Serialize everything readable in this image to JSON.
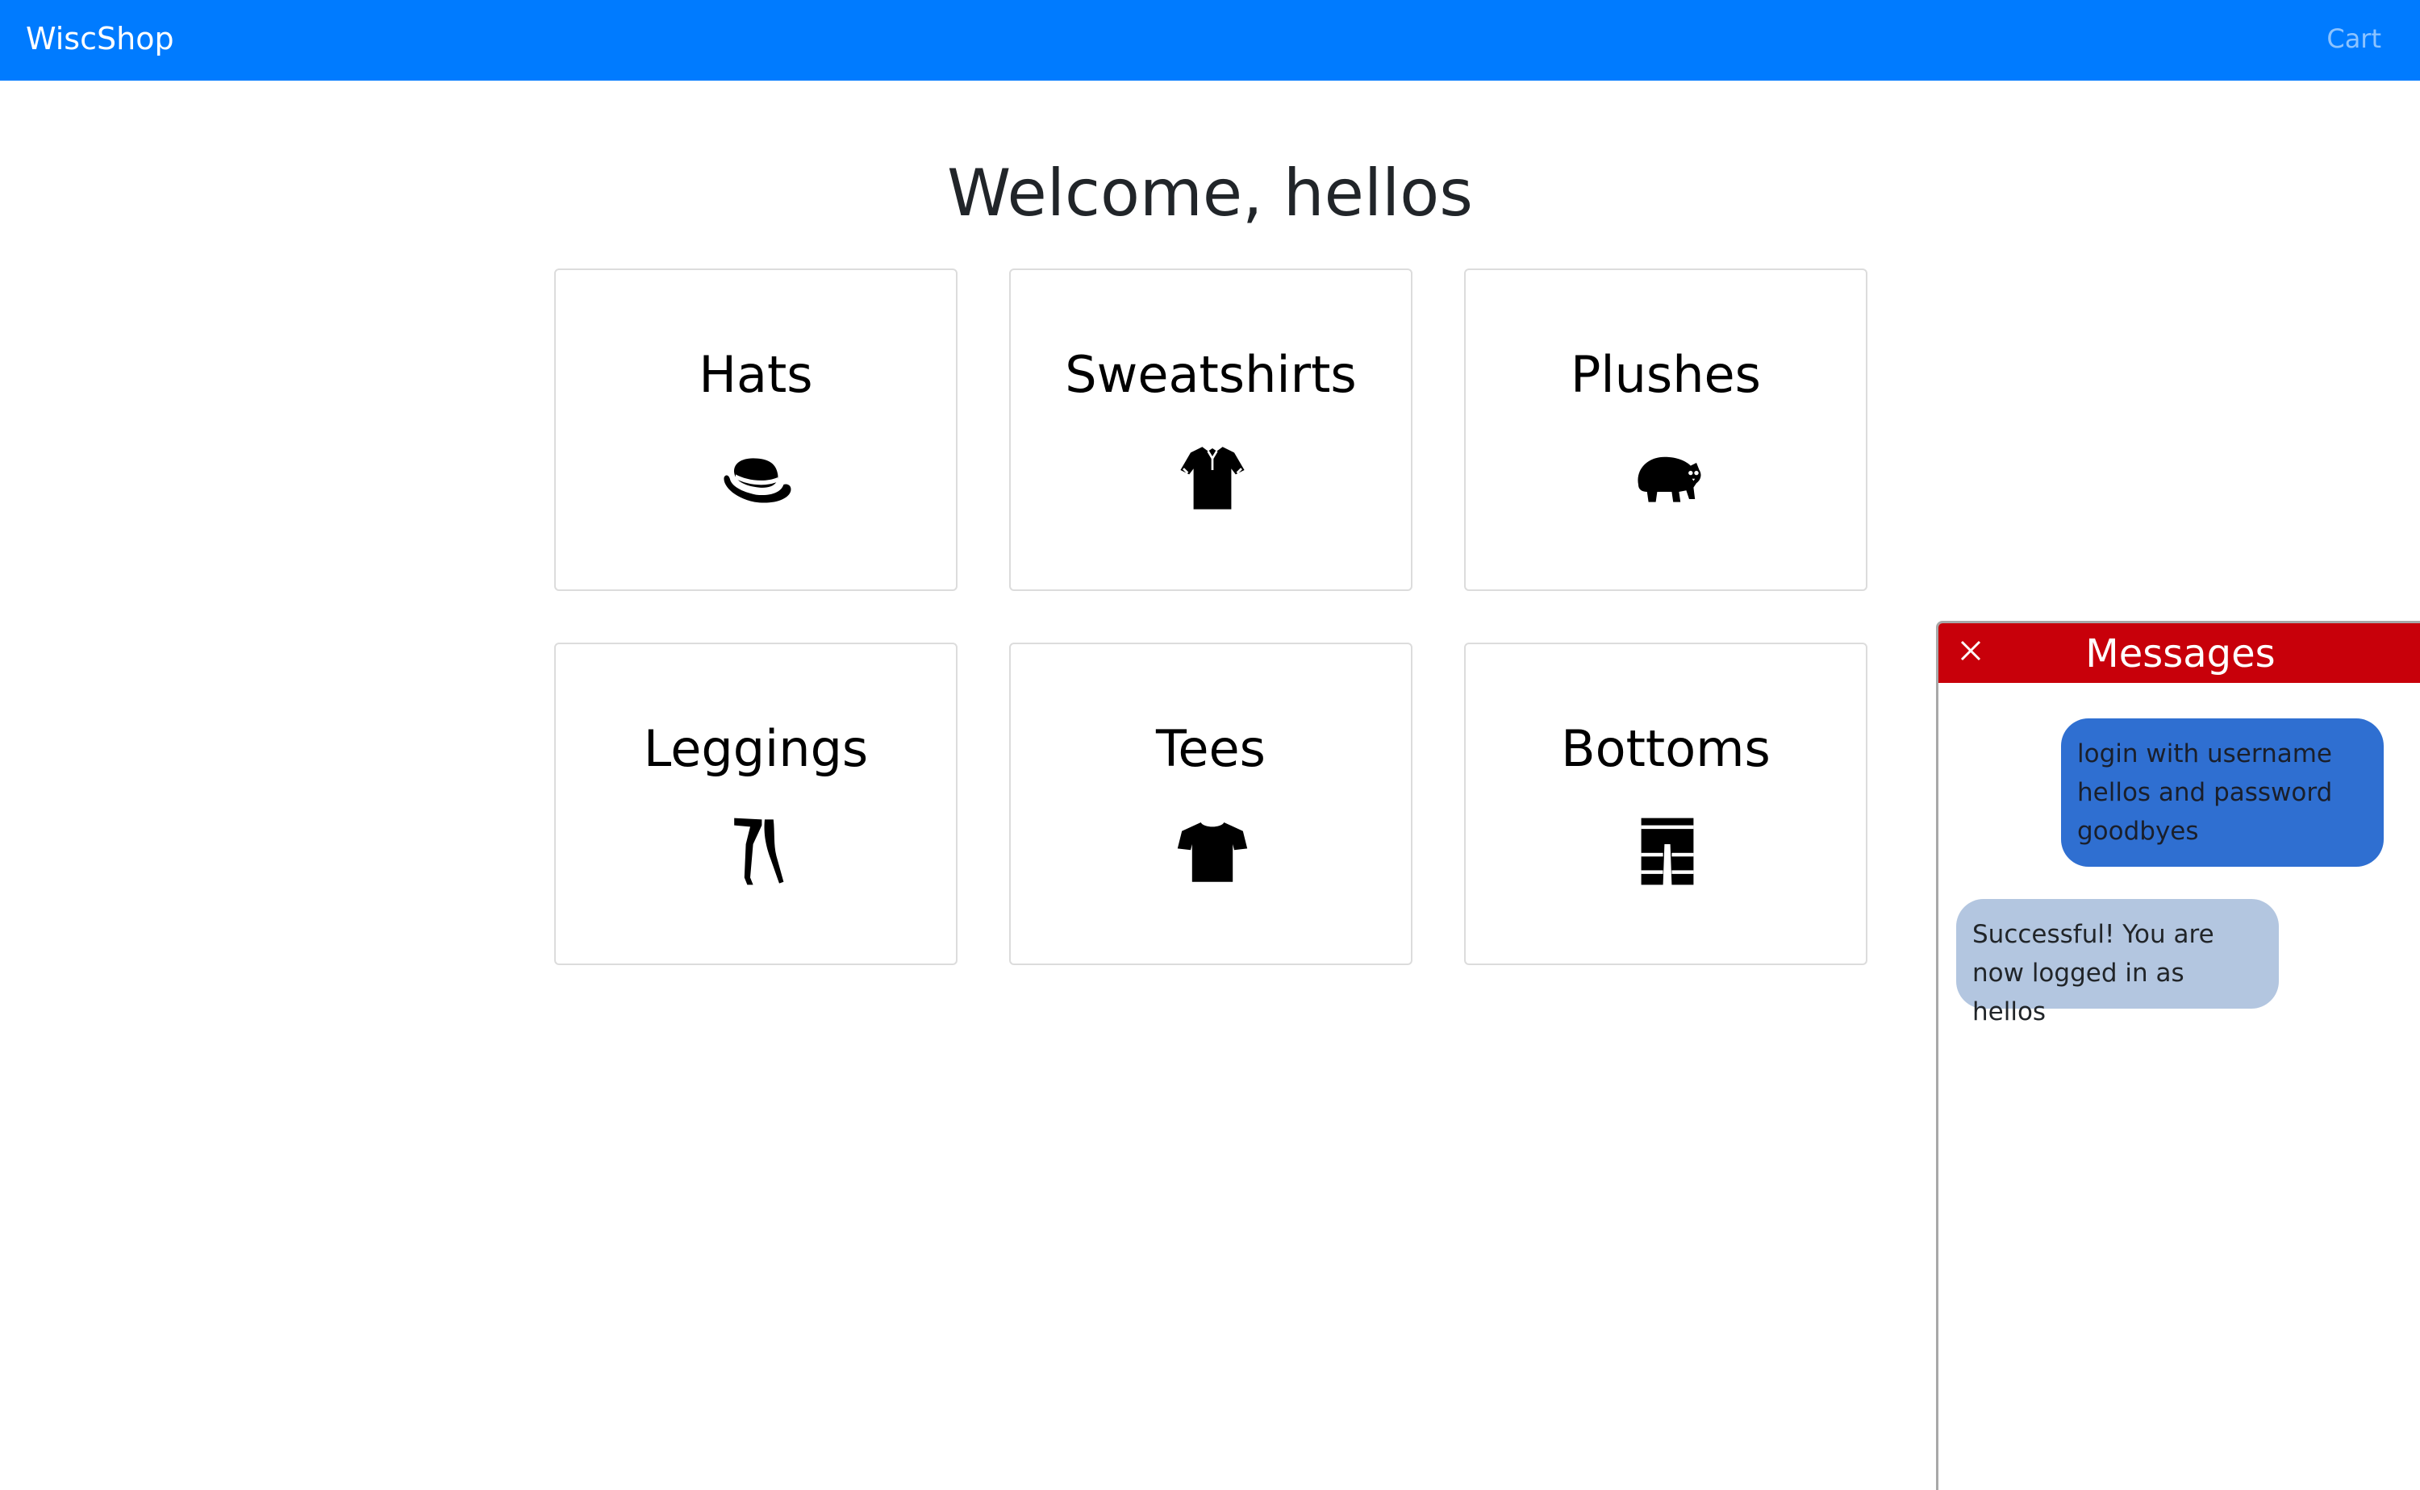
{
  "navbar": {
    "brand": "WiscShop",
    "cart_label": "Cart",
    "color": "#007bff"
  },
  "main": {
    "welcome": "Welcome, hellos",
    "categories": [
      {
        "label": "Hats",
        "icon": "hat-icon"
      },
      {
        "label": "Sweatshirts",
        "icon": "sweatshirt-icon"
      },
      {
        "label": "Plushes",
        "icon": "bear-icon"
      },
      {
        "label": "Leggings",
        "icon": "leggings-icon"
      },
      {
        "label": "Tees",
        "icon": "tshirt-icon"
      },
      {
        "label": "Bottoms",
        "icon": "pants-icon"
      }
    ]
  },
  "messages": {
    "title": "Messages",
    "header_color": "#c8000a",
    "close_icon": "close-icon",
    "items": [
      {
        "from": "user",
        "text": "login with username hellos and password goodbyes"
      },
      {
        "from": "bot",
        "text": "Successful! You are now logged in as hellos"
      }
    ]
  }
}
